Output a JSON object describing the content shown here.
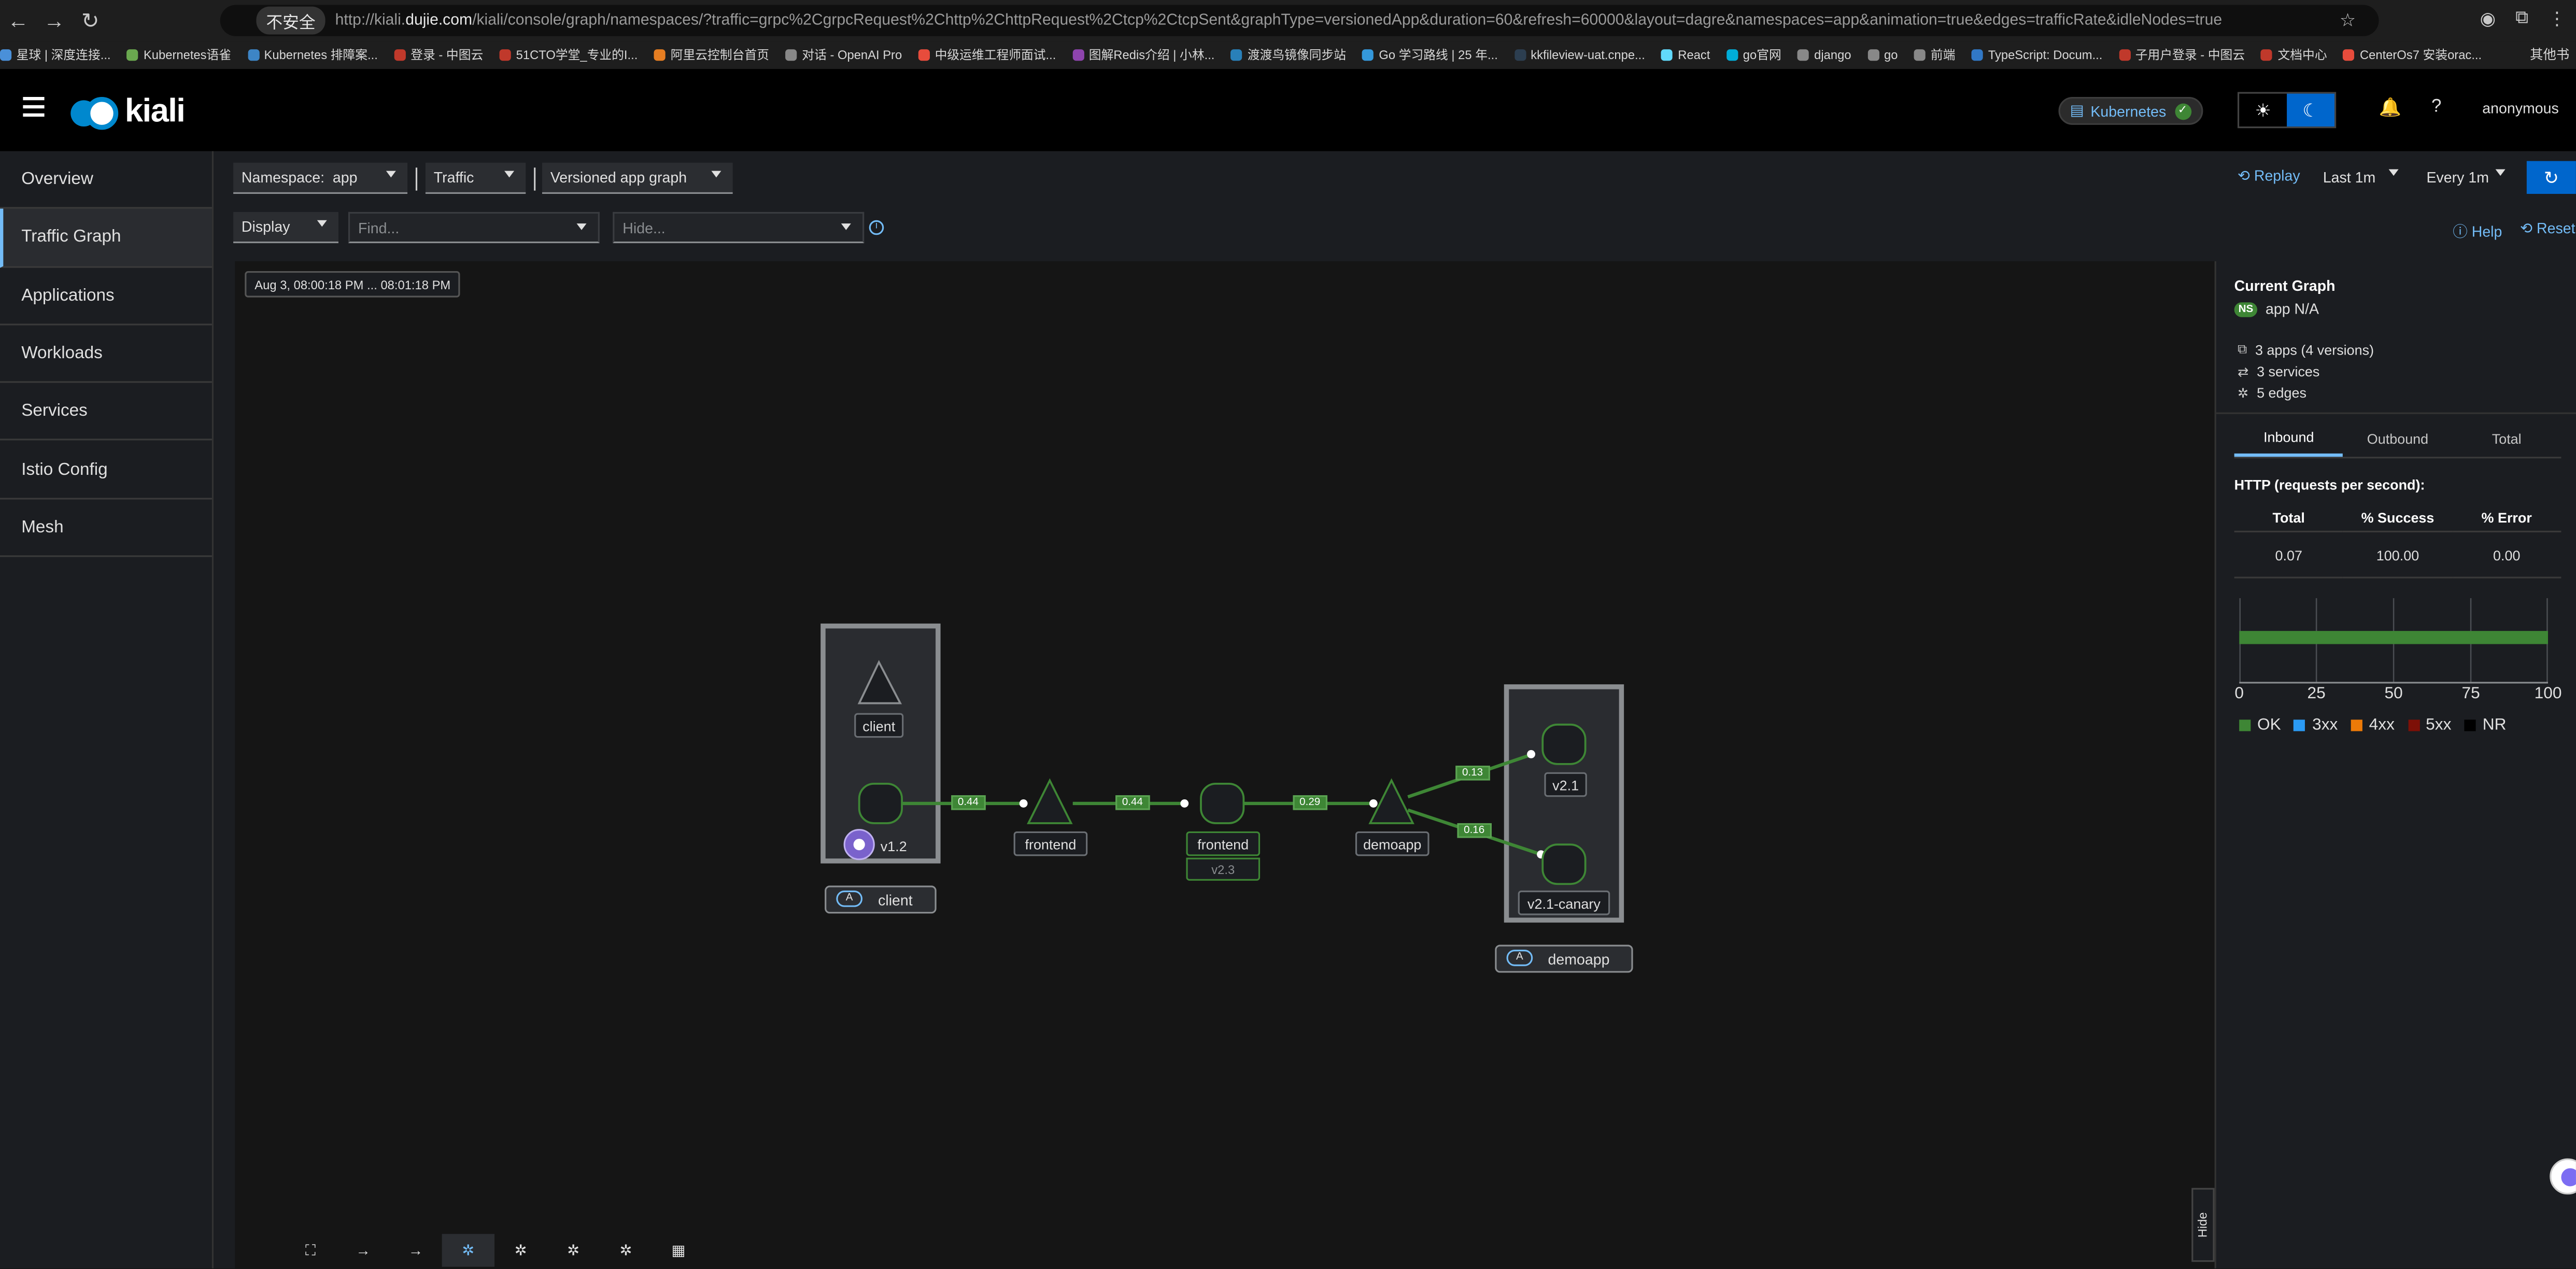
{
  "browser": {
    "security_warning": "不安全",
    "url_prefix": "http://kiali.",
    "url_domain": "dujie.com",
    "url_rest": "/kiali/console/graph/namespaces/?traffic=grpc%2CgrpcRequest%2Chttp%2ChttpRequest%2Ctcp%2CtcpSent&graphType=versionedApp&duration=60&refresh=60000&layout=dagre&namespaces=app&animation=true&edges=trafficRate&idleNodes=true",
    "bookmarks": [
      "星球 | 深度连接...",
      "Kubernetes语雀",
      "Kubernetes 排障案...",
      "登录 - 中图云",
      "51CTO学堂_专业的I...",
      "阿里云控制台首页",
      "对话 - OpenAI Pro",
      "中级运维工程师面试...",
      "图解Redis介绍 | 小林...",
      "渡渡鸟镜像同步站",
      "Go 学习路线 | 25 年...",
      "kkfileview-uat.cnpe...",
      "React",
      "go官网",
      "django",
      "go",
      "前端",
      "TypeScript: Docum...",
      "子用户登录 - 中图云",
      "文档中心",
      "CenterOs7 安装orac..."
    ],
    "bookmarks_more": "其他书"
  },
  "masthead": {
    "logo_text": "kiali",
    "cluster": "Kubernetes",
    "user": "anonymous"
  },
  "sidebar": {
    "items": [
      {
        "label": "Overview"
      },
      {
        "label": "Traffic Graph"
      },
      {
        "label": "Applications"
      },
      {
        "label": "Workloads"
      },
      {
        "label": "Services"
      },
      {
        "label": "Istio Config"
      },
      {
        "label": "Mesh"
      }
    ]
  },
  "toolbar": {
    "namespace": "Namespace:  app",
    "traffic": "Traffic",
    "graph_type": "Versioned app graph",
    "display": "Display",
    "find_placeholder": "Find...",
    "hide_placeholder": "Hide...",
    "replay": "Replay",
    "duration": "Last 1m",
    "refresh_interval": "Every 1m",
    "help": "Help",
    "reset": "Reset"
  },
  "graph": {
    "time_range": "Aug 3, 08:00:18 PM ... 08:01:18 PM",
    "nodes": {
      "client_service": "client",
      "client_version": "v1.2",
      "frontend_service": "frontend",
      "frontend_workload": "frontend",
      "frontend_version": "v2.3",
      "demoapp_service": "demoapp",
      "demoapp_v21": "v2.1",
      "demoapp_canary": "v2.1-canary"
    },
    "boxes": {
      "client_app": "client",
      "demoapp_app": "demoapp",
      "badge": "A"
    },
    "edges": {
      "e1": "0.44",
      "e2": "0.44",
      "e3": "0.29",
      "e4": "0.13",
      "e5": "0.16"
    },
    "hide_tab": "Hide"
  },
  "panel": {
    "title": "Current Graph",
    "ns_badge": "NS",
    "namespace": "app N/A",
    "apps": "3 apps (4 versions)",
    "services": "3 services",
    "edges": "5 edges",
    "tabs": [
      "Inbound",
      "Outbound",
      "Total"
    ],
    "http_title": "HTTP (requests per second):",
    "table": {
      "headers": [
        "Total",
        "% Success",
        "% Error"
      ],
      "values": [
        "0.07",
        "100.00",
        "0.00"
      ]
    },
    "chart": {
      "ticks": [
        "0",
        "25",
        "50",
        "75",
        "100"
      ],
      "ok_percent": 100
    },
    "legend": [
      {
        "label": "OK",
        "color": "#3e8635"
      },
      {
        "label": "3xx",
        "color": "#2b9af3"
      },
      {
        "label": "4xx",
        "color": "#ec7a08"
      },
      {
        "label": "5xx",
        "color": "#7d1007"
      },
      {
        "label": "NR",
        "color": "#000000"
      }
    ]
  }
}
